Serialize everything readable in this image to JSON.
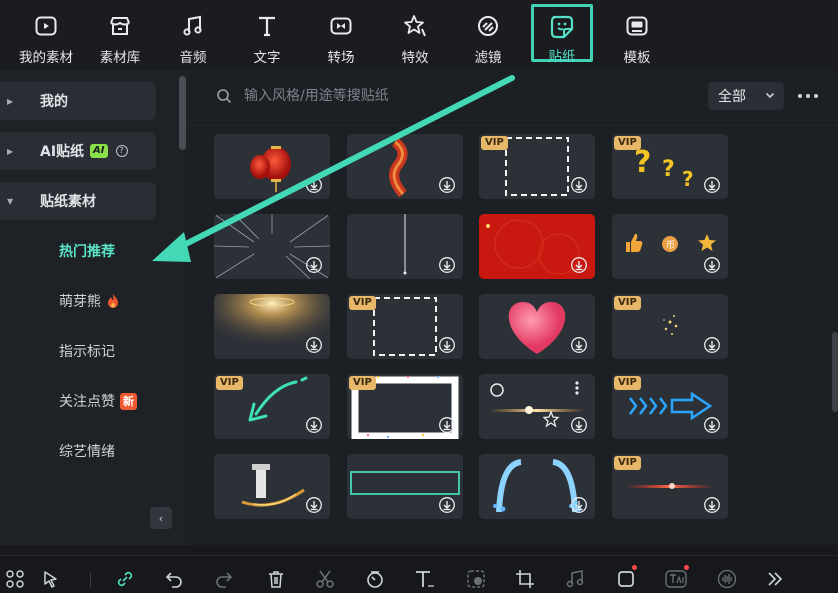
{
  "toolbar": {
    "items": [
      {
        "label": "我的素材",
        "icon": "my-media-icon"
      },
      {
        "label": "素材库",
        "icon": "stock-library-icon"
      },
      {
        "label": "音频",
        "icon": "audio-icon"
      },
      {
        "label": "文字",
        "icon": "text-icon"
      },
      {
        "label": "转场",
        "icon": "transition-icon"
      },
      {
        "label": "特效",
        "icon": "effects-icon"
      },
      {
        "label": "滤镜",
        "icon": "filter-icon"
      },
      {
        "label": "贴纸",
        "icon": "sticker-icon"
      },
      {
        "label": "模板",
        "icon": "template-icon"
      }
    ],
    "active_index": 7
  },
  "sidebar": {
    "categories": [
      {
        "label": "我的",
        "expanded": false
      },
      {
        "label": "AI贴纸",
        "badge": "AI",
        "expanded": false
      },
      {
        "label": "贴纸素材",
        "expanded": true
      }
    ],
    "subitems": [
      {
        "label": "热门推荐",
        "active": true
      },
      {
        "label": "萌芽熊",
        "badge": "flame"
      },
      {
        "label": "指示标记"
      },
      {
        "label": "关注点赞",
        "badge": "新"
      },
      {
        "label": "综艺情绪"
      }
    ],
    "collapse_glyph": "‹"
  },
  "main": {
    "search_placeholder": "输入风格/用途等搜贴纸",
    "filter_label": "全部",
    "vip_label": "VIP",
    "cards": [
      {
        "art": "lanterns",
        "vip": false
      },
      {
        "art": "red-ribbon",
        "vip": false
      },
      {
        "art": "dashed-frame",
        "vip": true
      },
      {
        "art": "question-marks",
        "vip": true
      },
      {
        "art": "speed-lines",
        "vip": false
      },
      {
        "art": "hanging-line",
        "vip": false
      },
      {
        "art": "red-background",
        "vip": false
      },
      {
        "art": "like-coin-star",
        "vip": false
      },
      {
        "art": "light-burst",
        "vip": false
      },
      {
        "art": "dashed-frame",
        "vip": true
      },
      {
        "art": "pink-heart",
        "vip": false
      },
      {
        "art": "sparkles",
        "vip": true
      },
      {
        "art": "green-arrow",
        "vip": true
      },
      {
        "art": "confetti-frame",
        "vip": true
      },
      {
        "art": "lens-flare-star",
        "vip": false
      },
      {
        "art": "blue-neon-arrow",
        "vip": true
      },
      {
        "art": "golden-swirl",
        "vip": false
      },
      {
        "art": "teal-bar",
        "vip": false
      },
      {
        "art": "water-arcs",
        "vip": false
      },
      {
        "art": "red-flare",
        "vip": true
      }
    ]
  },
  "bottombar": {
    "tools": [
      "grid-icon",
      "select-icon",
      "link-icon",
      "undo-icon",
      "redo-icon",
      "delete-icon",
      "cut-icon",
      "speed-icon",
      "text-tool-icon",
      "mask-icon",
      "crop-icon",
      "audio-tool-icon",
      "shape-icon",
      "ai-text-icon",
      "voice-icon",
      "more-forward-icon"
    ]
  },
  "colors": {
    "accent": "#3fd2b5",
    "vip": "#e7b86a",
    "panel": "#1e2126",
    "card": "#2c3037"
  }
}
